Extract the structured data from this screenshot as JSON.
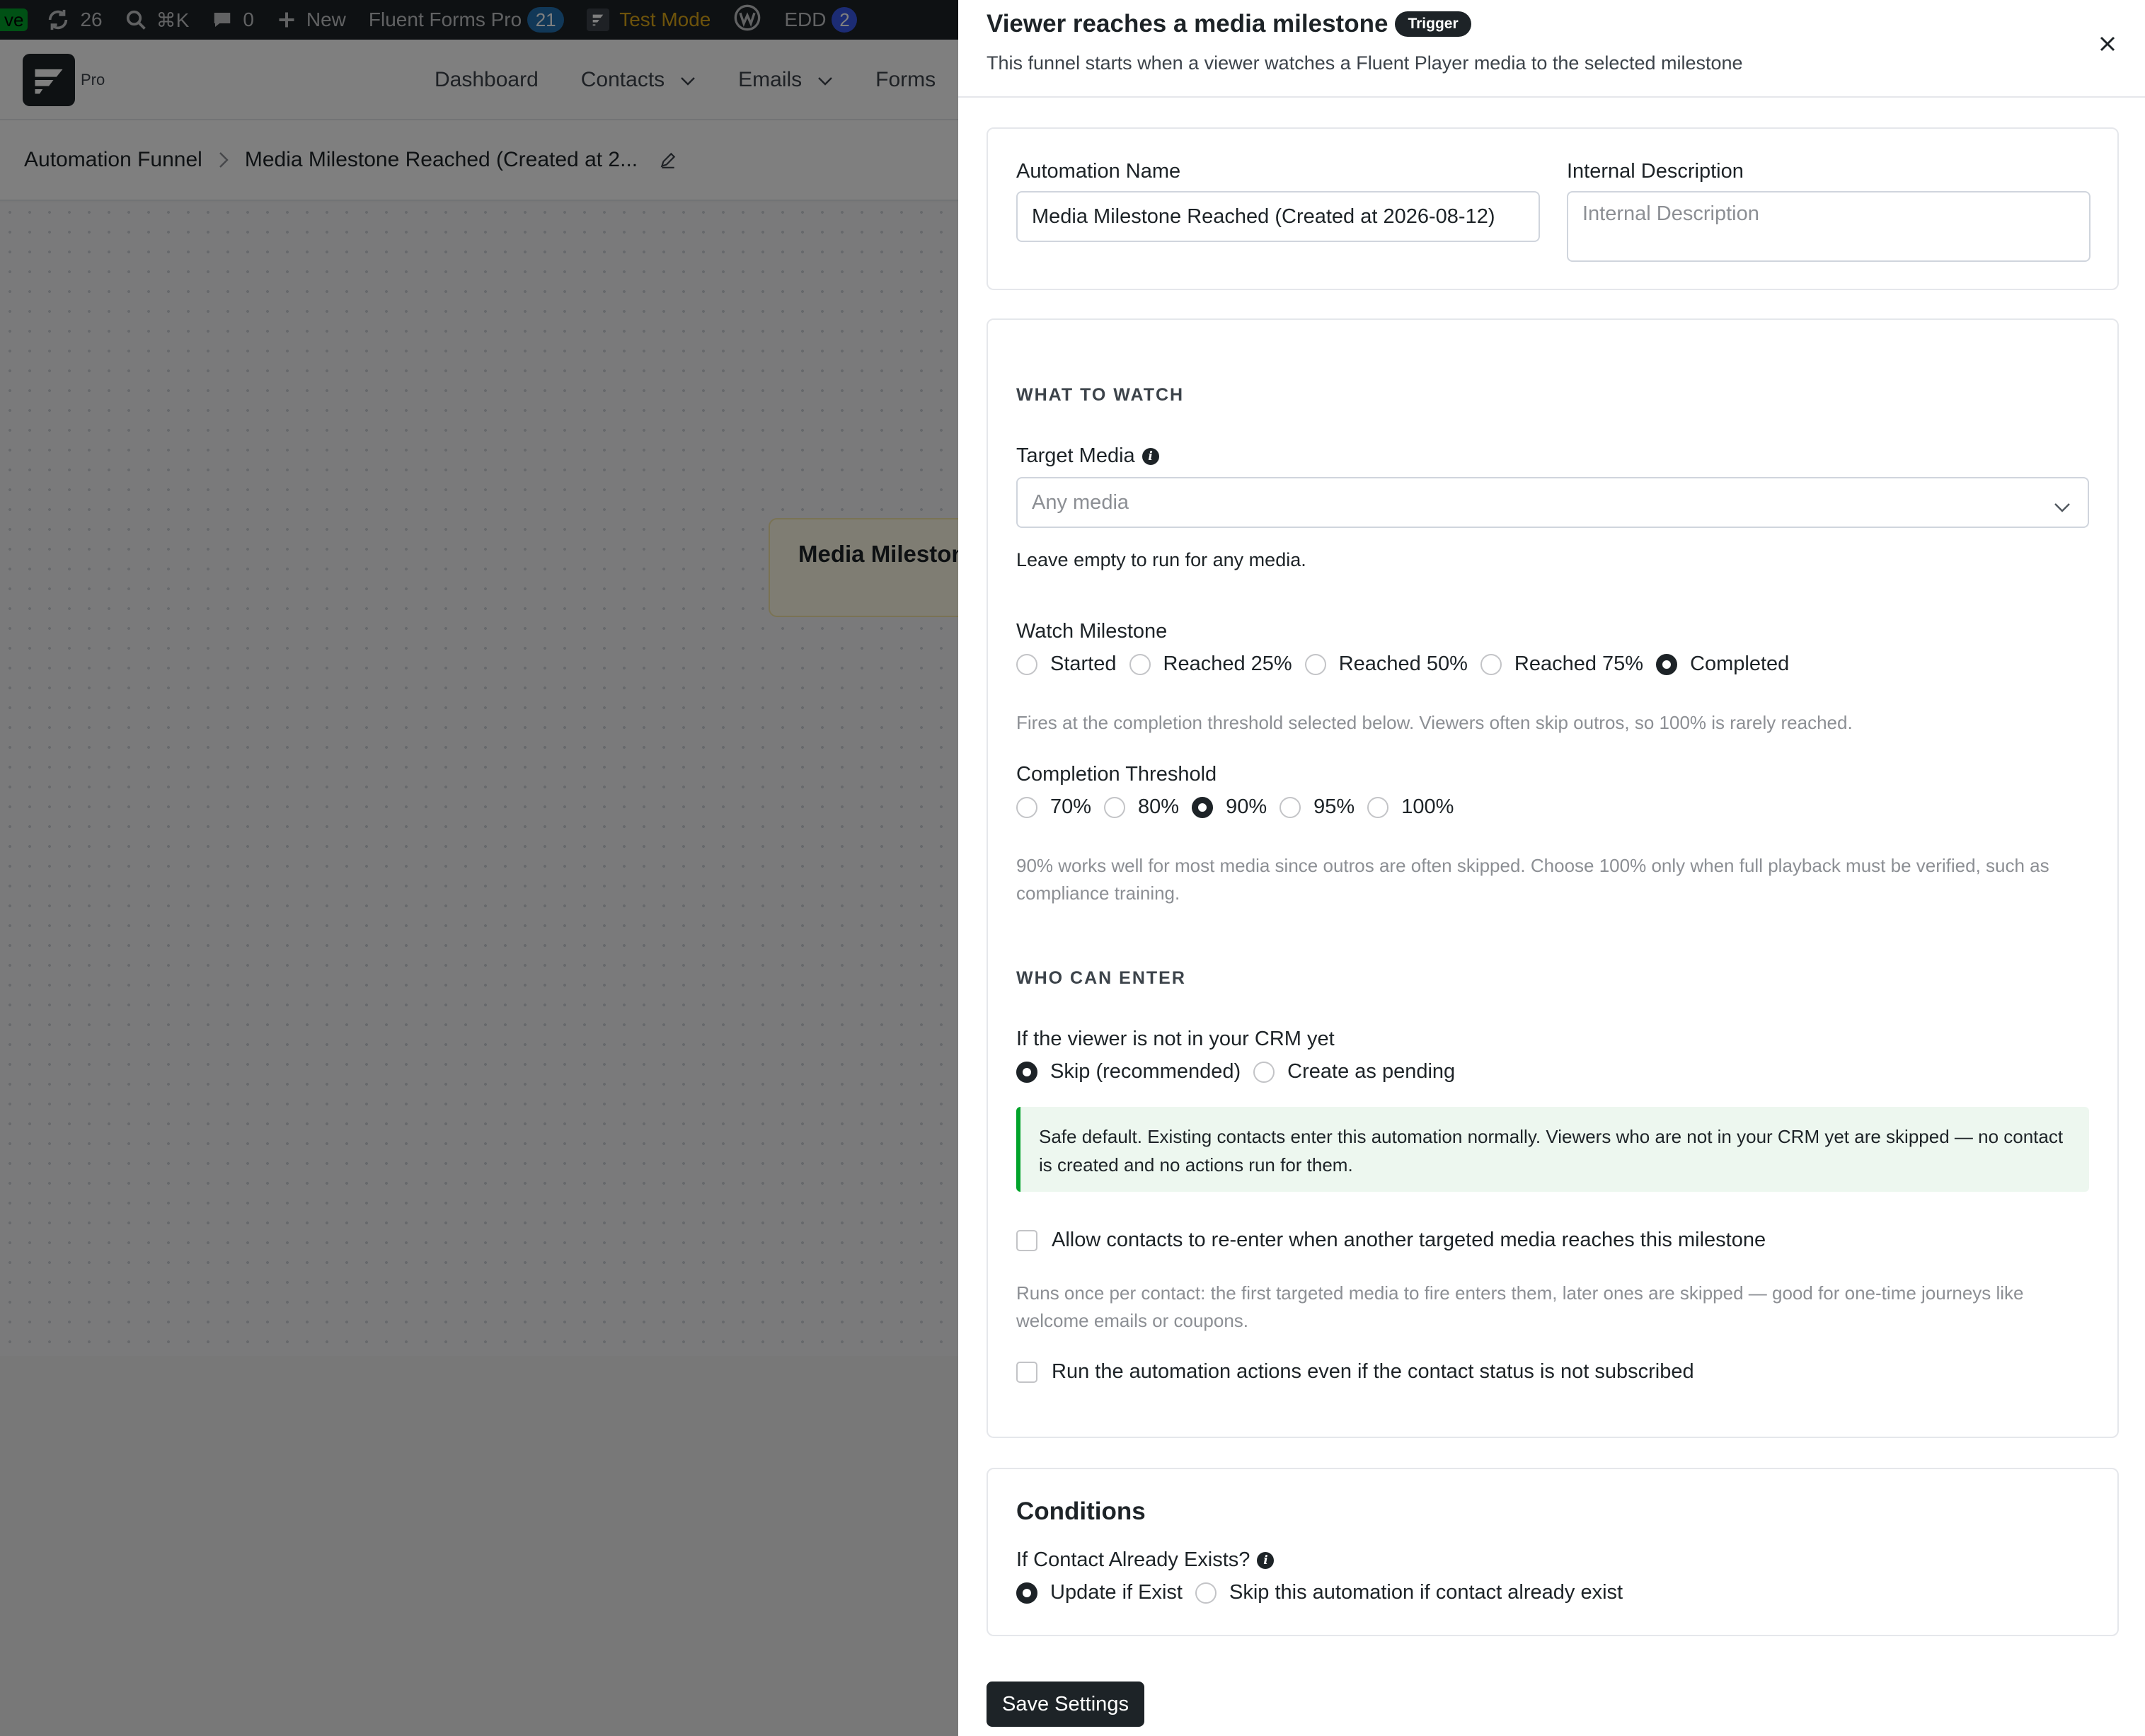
{
  "adminbar": {
    "live": "ve",
    "updates": "26",
    "search_shortcut": "⌘K",
    "comments": "0",
    "new_label": "New",
    "fluent_forms": "Fluent Forms Pro",
    "fluent_forms_count": "21",
    "test_mode": "Test Mode",
    "edd": "EDD",
    "edd_count": "2"
  },
  "app": {
    "logo_suffix": "Pro",
    "nav": [
      "Dashboard",
      "Contacts",
      "Emails",
      "Forms"
    ],
    "breadcrumb": {
      "root": "Automation Funnel",
      "current": "Media Milestone Reached (Created at 2..."
    },
    "node_title": "Media Milestone Reached"
  },
  "drawer": {
    "title": "Viewer reaches a media milestone",
    "badge": "Trigger",
    "subtitle": "This funnel starts when a viewer watches a Fluent Player media to the selected milestone",
    "automation_name_label": "Automation Name",
    "automation_name_value": "Media Milestone Reached (Created at 2026-08-12)",
    "internal_description_label": "Internal Description",
    "internal_description_placeholder": "Internal Description",
    "what_to_watch": "WHAT TO WATCH",
    "target_media_label": "Target Media",
    "target_media_placeholder": "Any media",
    "target_media_help": "Leave empty to run for any media.",
    "watch_milestone_label": "Watch Milestone",
    "milestones": [
      "Started",
      "Reached 25%",
      "Reached 50%",
      "Reached 75%",
      "Completed"
    ],
    "milestone_selected": "Completed",
    "milestone_help": "Fires at the completion threshold selected below. Viewers often skip outros, so 100% is rarely reached.",
    "threshold_label": "Completion Threshold",
    "thresholds": [
      "70%",
      "80%",
      "90%",
      "95%",
      "100%"
    ],
    "threshold_selected": "90%",
    "threshold_help": "90% works well for most media since outros are often skipped. Choose 100% only when full playback must be verified, such as compliance training.",
    "who_can_enter": "WHO CAN ENTER",
    "not_in_crm_label": "If the viewer is not in your CRM yet",
    "crm_options": [
      "Skip (recommended)",
      "Create as pending"
    ],
    "crm_selected": "Skip (recommended)",
    "notice": "Safe default. Existing contacts enter this automation normally. Viewers who are not in your CRM yet are skipped — no contact is created and no actions run for them.",
    "reenter_label": "Allow contacts to re-enter when another targeted media reaches this milestone",
    "reenter_help": "Runs once per contact: the first targeted media to fire enters them, later ones are skipped — good for one-time journeys like welcome emails or coupons.",
    "run_unsubscribed_label": "Run the automation actions even if the contact status is not subscribed",
    "conditions_title": "Conditions",
    "contact_exists_label": "If Contact Already Exists?",
    "contact_exists_options": [
      "Update if Exist",
      "Skip this automation if contact already exist"
    ],
    "contact_exists_selected": "Update if Exist",
    "save_label": "Save Settings"
  }
}
